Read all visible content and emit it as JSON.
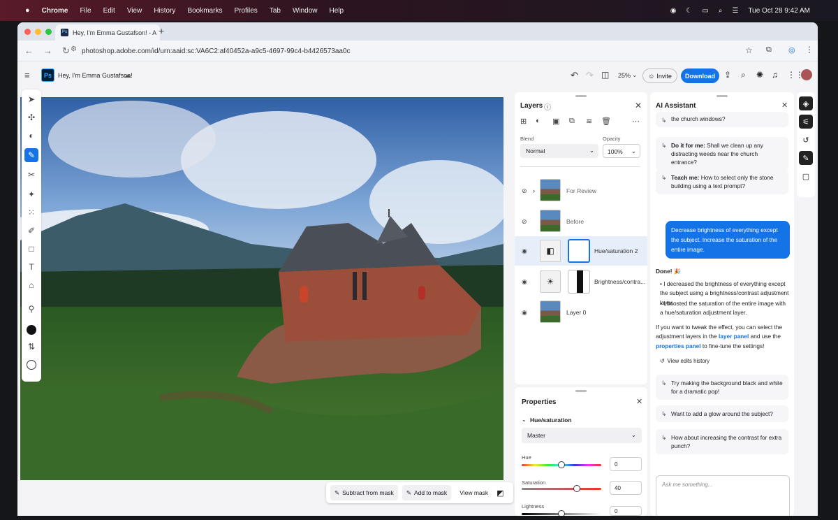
{
  "menubar": {
    "items": [
      "Chrome",
      "File",
      "Edit",
      "View",
      "History",
      "Bookmarks",
      "Profiles",
      "Tab",
      "Window",
      "Help"
    ],
    "clock": "Tue Oct 28  9:42 AM"
  },
  "browser": {
    "tab_title": "Hey, I'm Emma Gustafson! - A",
    "url": "photoshop.adobe.com/id/urn:aaid:sc:VA6C2:af40452a-a9c5-4697-99c4-b4426573aa0c"
  },
  "header": {
    "doc_title": "Hey, I'm Emma Gustafson!",
    "zoom": "25%",
    "invite_label": "Invite",
    "download_label": "Download",
    "accent": "#1473e6"
  },
  "mask_toolbar": {
    "subtract": "Subtract from mask",
    "add": "Add to mask",
    "view": "View mask"
  },
  "layers": {
    "title": "Layers",
    "blend_label": "Blend",
    "blend_value": "Normal",
    "opacity_label": "Opacity",
    "opacity_value": "100%",
    "items": [
      {
        "name": "For Review"
      },
      {
        "name": "Before"
      },
      {
        "name": "Hue/saturation 2"
      },
      {
        "name": "Brightness/contra..."
      },
      {
        "name": "Layer 0"
      }
    ]
  },
  "properties": {
    "title": "Properties",
    "section": "Hue/saturation",
    "channel": "Master",
    "hue_label": "Hue",
    "hue_value": "0",
    "sat_label": "Saturation",
    "sat_value": "40",
    "light_label": "Lightness",
    "light_value": "0"
  },
  "ai": {
    "title": "AI Assistant",
    "s0": "the church windows?",
    "s1_bold": "Do it for me:",
    "s1": " Shall we clean up any distracting weeds near the church entrance?",
    "s2_bold": "Teach me:",
    "s2": " How to select only the stone building using a text prompt?",
    "user_msg": "Decrease brightness of everything except the subject. Increase the saturation of the entire image.",
    "done": "Done! 🎉",
    "bullet1": "I decreased the brightness of everything except the subject using a brightness/contrast adjustment layer.",
    "bullet2": "I boosted the saturation of the entire image with a hue/saturation adjustment layer.",
    "tweak_a": "If you want to tweak the effect, you can select the adjustment layers in the ",
    "tweak_link1": "layer panel",
    "tweak_b": " and use the ",
    "tweak_link2": "properties panel",
    "tweak_c": " to fine-tune the settings!",
    "history": "View edits history",
    "s3": "Try making the background black and white for a dramatic pop!",
    "s4": "Want to add a glow around the subject?",
    "s5": "How about increasing the contrast for extra punch?",
    "placeholder": "Ask me something..."
  }
}
